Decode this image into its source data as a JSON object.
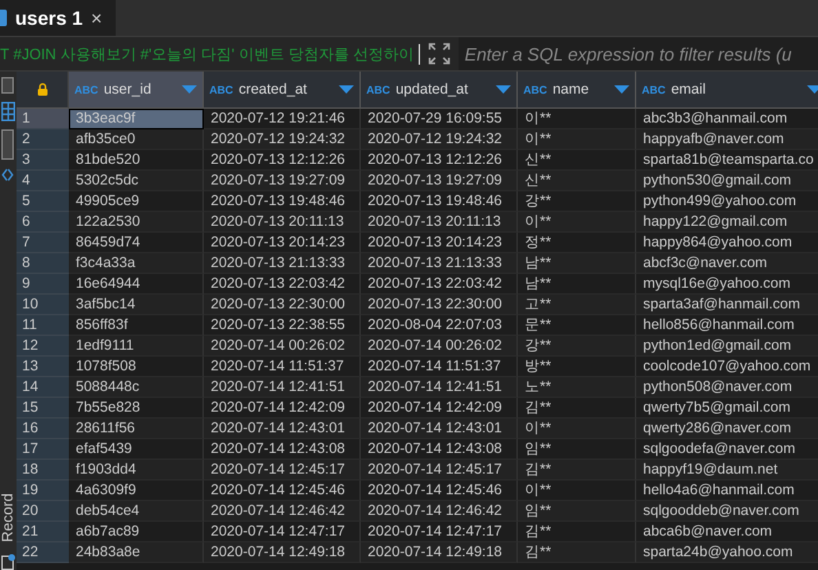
{
  "tab": {
    "label": "users 1",
    "close": "×",
    "selected": true
  },
  "filter": {
    "query": "T #JOIN 사용해보기 #'오늘의 다짐' 이벤트 당첨자를 선정하이",
    "placeholder": "Enter a SQL expression to filter results (u"
  },
  "side_panel": {
    "label": "Record"
  },
  "table": {
    "columns": [
      {
        "type_label": "ABC",
        "name": "user_id",
        "selected": true
      },
      {
        "type_label": "ABC",
        "name": "created_at",
        "selected": false
      },
      {
        "type_label": "ABC",
        "name": "updated_at",
        "selected": false
      },
      {
        "type_label": "ABC",
        "name": "name",
        "selected": false
      },
      {
        "type_label": "ABC",
        "name": "email",
        "selected": false
      }
    ],
    "rows": [
      {
        "num": "1",
        "selected": true,
        "cells": [
          "3b3eac9f",
          "2020-07-12 19:21:46",
          "2020-07-29 16:09:55",
          "이**",
          "abc3b3@hanmail.com"
        ]
      },
      {
        "num": "2",
        "selected": false,
        "cells": [
          "afb35ce0",
          "2020-07-12 19:24:32",
          "2020-07-12 19:24:32",
          "이**",
          "happyafb@naver.com"
        ]
      },
      {
        "num": "3",
        "selected": false,
        "cells": [
          "81bde520",
          "2020-07-13 12:12:26",
          "2020-07-13 12:12:26",
          "신**",
          "sparta81b@teamsparta.co"
        ]
      },
      {
        "num": "4",
        "selected": false,
        "cells": [
          "5302c5dc",
          "2020-07-13 19:27:09",
          "2020-07-13 19:27:09",
          "신**",
          "python530@gmail.com"
        ]
      },
      {
        "num": "5",
        "selected": false,
        "cells": [
          "49905ce9",
          "2020-07-13 19:48:46",
          "2020-07-13 19:48:46",
          "강**",
          "python499@yahoo.com"
        ]
      },
      {
        "num": "6",
        "selected": false,
        "cells": [
          "122a2530",
          "2020-07-13 20:11:13",
          "2020-07-13 20:11:13",
          "이**",
          "happy122@gmail.com"
        ]
      },
      {
        "num": "7",
        "selected": false,
        "cells": [
          "86459d74",
          "2020-07-13 20:14:23",
          "2020-07-13 20:14:23",
          "정**",
          "happy864@yahoo.com"
        ]
      },
      {
        "num": "8",
        "selected": false,
        "cells": [
          "f3c4a33a",
          "2020-07-13 21:13:33",
          "2020-07-13 21:13:33",
          "남**",
          "abcf3c@naver.com"
        ]
      },
      {
        "num": "9",
        "selected": false,
        "cells": [
          "16e64944",
          "2020-07-13 22:03:42",
          "2020-07-13 22:03:42",
          "남**",
          "mysql16e@yahoo.com"
        ]
      },
      {
        "num": "10",
        "selected": false,
        "cells": [
          "3af5bc14",
          "2020-07-13 22:30:00",
          "2020-07-13 22:30:00",
          "고**",
          "sparta3af@hanmail.com"
        ]
      },
      {
        "num": "11",
        "selected": false,
        "cells": [
          "856ff83f",
          "2020-07-13 22:38:55",
          "2020-08-04 22:07:03",
          "문**",
          "hello856@hanmail.com"
        ]
      },
      {
        "num": "12",
        "selected": false,
        "cells": [
          "1edf9111",
          "2020-07-14 00:26:02",
          "2020-07-14 00:26:02",
          "강**",
          "python1ed@gmail.com"
        ]
      },
      {
        "num": "13",
        "selected": false,
        "cells": [
          "1078f508",
          "2020-07-14 11:51:37",
          "2020-07-14 11:51:37",
          "방**",
          "coolcode107@yahoo.com"
        ]
      },
      {
        "num": "14",
        "selected": false,
        "cells": [
          "5088448c",
          "2020-07-14 12:41:51",
          "2020-07-14 12:41:51",
          "노**",
          "python508@naver.com"
        ]
      },
      {
        "num": "15",
        "selected": false,
        "cells": [
          "7b55e828",
          "2020-07-14 12:42:09",
          "2020-07-14 12:42:09",
          "김**",
          "qwerty7b5@gmail.com"
        ]
      },
      {
        "num": "16",
        "selected": false,
        "cells": [
          "28611f56",
          "2020-07-14 12:43:01",
          "2020-07-14 12:43:01",
          "이**",
          "qwerty286@naver.com"
        ]
      },
      {
        "num": "17",
        "selected": false,
        "cells": [
          "efaf5439",
          "2020-07-14 12:43:08",
          "2020-07-14 12:43:08",
          "임**",
          "sqlgoodefa@naver.com"
        ]
      },
      {
        "num": "18",
        "selected": false,
        "cells": [
          "f1903dd4",
          "2020-07-14 12:45:17",
          "2020-07-14 12:45:17",
          "김**",
          "happyf19@daum.net"
        ]
      },
      {
        "num": "19",
        "selected": false,
        "cells": [
          "4a6309f9",
          "2020-07-14 12:45:46",
          "2020-07-14 12:45:46",
          "이**",
          "hello4a6@hanmail.com"
        ]
      },
      {
        "num": "20",
        "selected": false,
        "cells": [
          "deb54ce4",
          "2020-07-14 12:46:42",
          "2020-07-14 12:46:42",
          "임**",
          "sqlgooddeb@naver.com"
        ]
      },
      {
        "num": "21",
        "selected": false,
        "cells": [
          "a6b7ac89",
          "2020-07-14 12:47:17",
          "2020-07-14 12:47:17",
          "김**",
          "abca6b@naver.com"
        ]
      },
      {
        "num": "22",
        "selected": false,
        "cells": [
          "24b83a8e",
          "2020-07-14 12:49:18",
          "2020-07-14 12:49:18",
          "김**",
          "sparta24b@yahoo.com"
        ]
      }
    ]
  }
}
